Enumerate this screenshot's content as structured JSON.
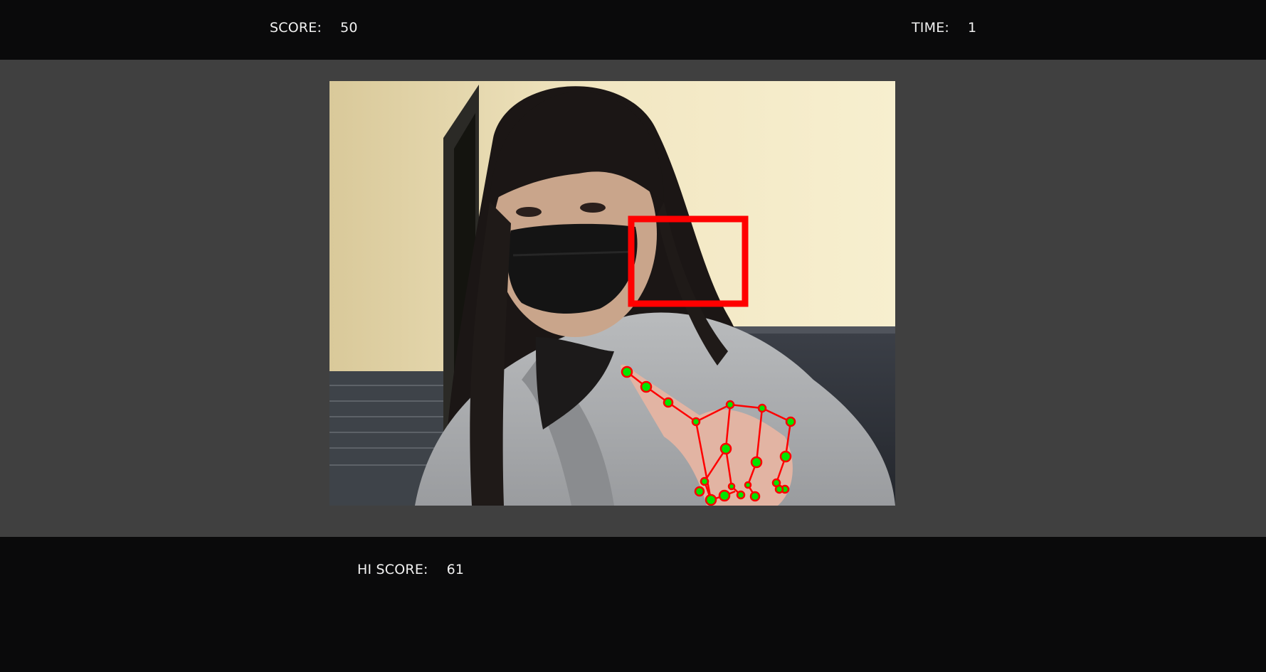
{
  "hud": {
    "score_label": "SCORE:",
    "score_value": "50",
    "time_label": "TIME:",
    "time_value": "1"
  },
  "footer": {
    "hiscore_label": "HI SCORE:",
    "hiscore_value": "61"
  },
  "colors": {
    "bar_background": "#0a0a0b",
    "stage_background": "#404040",
    "target_box": "#ff0000",
    "landmark_fill": "#00e600",
    "landmark_stroke": "#ff0000"
  },
  "icons": {
    "target": "red-square-target",
    "hand_landmarks": "hand-skeleton-overlay"
  }
}
